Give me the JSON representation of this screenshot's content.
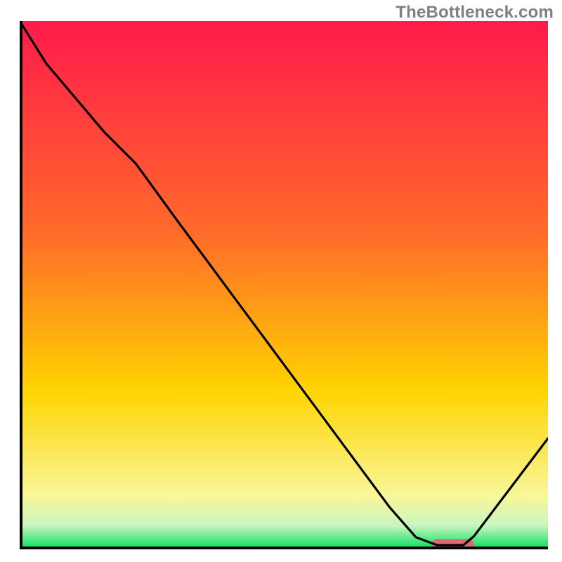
{
  "watermark": "TheBottleneck.com",
  "colors": {
    "axis": "#000000",
    "curve": "#000000",
    "marker": "#d96a6e",
    "gradient_top": "#ff1a4b",
    "gradient_upper": "#ff6a2a",
    "gradient_mid": "#ffd400",
    "gradient_lower": "#f8f79a",
    "gradient_base_upper": "#c9f5c0",
    "gradient_base_lower": "#00e05a"
  },
  "chart_data": {
    "type": "line",
    "title": "",
    "xlabel": "",
    "ylabel": "",
    "xlim": [
      0,
      100
    ],
    "ylim": [
      0,
      100
    ],
    "x": [
      0,
      5,
      16,
      22,
      30,
      40,
      50,
      60,
      70,
      75,
      79,
      84,
      86,
      100
    ],
    "values": [
      100,
      92,
      79,
      73,
      62,
      48.5,
      35,
      21.5,
      8,
      2.3,
      0.8,
      0.8,
      2.5,
      21
    ],
    "marker": {
      "x_start": 78,
      "x_end": 86,
      "y": 0.9,
      "thickness": 2.1
    },
    "gradient_stops": [
      {
        "offset": 0.0,
        "key": "gradient_top"
      },
      {
        "offset": 0.4,
        "key": "gradient_upper"
      },
      {
        "offset": 0.7,
        "key": "gradient_mid"
      },
      {
        "offset": 0.9,
        "key": "gradient_lower"
      },
      {
        "offset": 0.955,
        "key": "gradient_base_upper"
      },
      {
        "offset": 1.0,
        "key": "gradient_base_lower"
      }
    ]
  }
}
